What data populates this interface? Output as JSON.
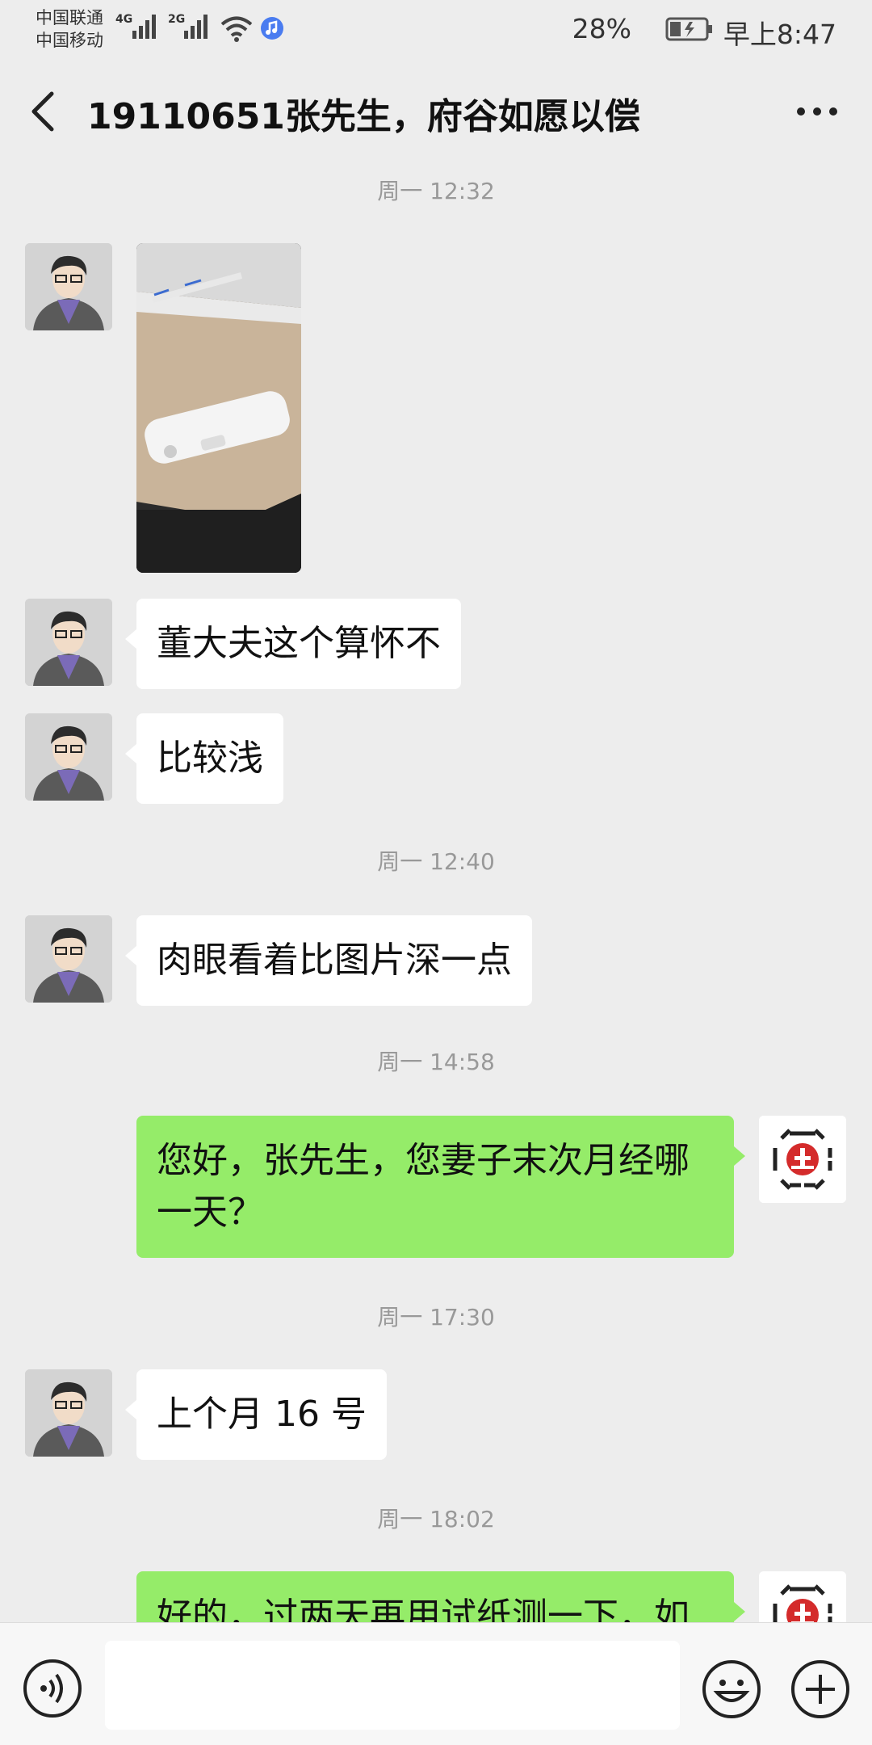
{
  "status": {
    "carrier1": "中国联通",
    "carrier2": "中国移动",
    "net1": "4G",
    "net2": "2G",
    "battery": "28%",
    "time": "早上8:47",
    "colors": {
      "music_badge": "#4a7cf0"
    }
  },
  "header": {
    "title": "19110651张先生，府谷如愿以偿",
    "back_icon": "chevron-left-icon",
    "more_icon": "more-dots-icon"
  },
  "chat": {
    "timestamps": [
      "周一 12:32",
      "周一 12:40",
      "周一 14:58",
      "周一 17:30",
      "周一 18:02"
    ],
    "messages": [
      {
        "side": "left",
        "type": "image"
      },
      {
        "side": "left",
        "text": "董大夫这个算怀不"
      },
      {
        "side": "left",
        "text": "比较浅"
      },
      {
        "side": "left",
        "text": "肉眼看着比图片深一点"
      },
      {
        "side": "right",
        "text": "您好，张先生，您妻子末次月经哪一天？"
      },
      {
        "side": "left",
        "text": "上个月 16 号"
      },
      {
        "side": "right",
        "text": "好的，过两天再用试纸测一下，如"
      }
    ],
    "colors": {
      "self_bubble": "#95ec69",
      "other_bubble": "#ffffff",
      "background": "#ededed"
    }
  },
  "input_bar": {
    "placeholder": "",
    "icons": [
      "voice-icon",
      "emoji-icon",
      "plus-icon"
    ]
  }
}
